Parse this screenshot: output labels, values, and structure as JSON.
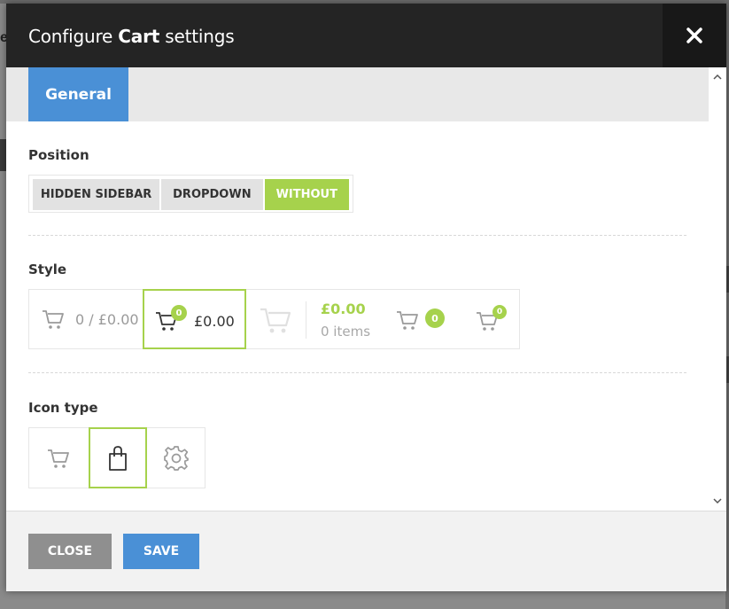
{
  "dialog": {
    "title_prefix": "Configure ",
    "title_bold": "Cart",
    "title_suffix": " settings",
    "close_glyph": "✕"
  },
  "tabs": [
    {
      "label": "General",
      "active": true
    }
  ],
  "position": {
    "label": "Position",
    "options": [
      {
        "label": "HIDDEN SIDEBAR",
        "active": false
      },
      {
        "label": "DROPDOWN",
        "active": false
      },
      {
        "label": "WITHOUT",
        "active": true
      }
    ]
  },
  "style": {
    "label": "Style",
    "options": [
      {
        "icon": "cart-icon",
        "text": "0 / £0.00",
        "selected": false
      },
      {
        "icon": "cart-icon",
        "badge": "0",
        "text": "£0.00",
        "selected": true
      },
      {
        "icon": "cart-icon",
        "amount": "£0.00",
        "items": "0 items",
        "selected": false
      },
      {
        "icon": "cart-icon",
        "badge": "0",
        "selected": false
      },
      {
        "icon": "cart-icon",
        "badge": "0",
        "selected": false
      }
    ]
  },
  "icon_type": {
    "label": "Icon type",
    "options": [
      {
        "icon": "cart-icon",
        "selected": false
      },
      {
        "icon": "shopping-bag-icon",
        "selected": true
      },
      {
        "icon": "gear-icon",
        "selected": false
      }
    ]
  },
  "footer": {
    "close_label": "CLOSE",
    "save_label": "SAVE"
  },
  "colors": {
    "header_bg": "#242424",
    "accent_blue": "#4a90d6",
    "accent_green": "#a6d24c",
    "close_button_bg": "#8f8f8f"
  }
}
